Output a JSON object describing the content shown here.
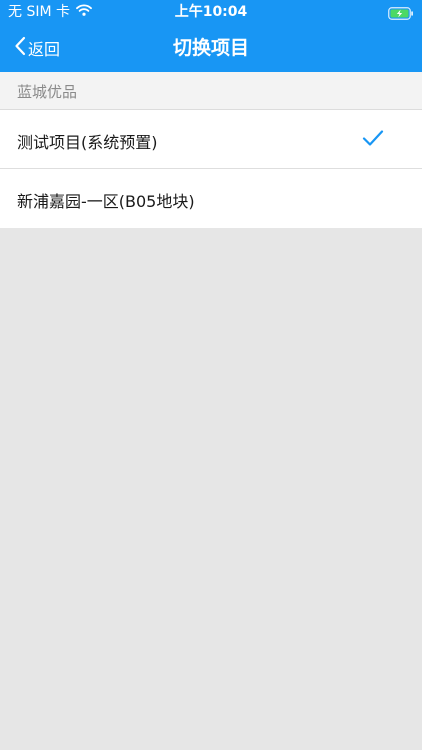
{
  "status_bar": {
    "carrier": "无 SIM 卡",
    "time": "上午10:04"
  },
  "nav": {
    "back_label": "返回",
    "title": "切换项目"
  },
  "section": {
    "header": "蓝城优品"
  },
  "projects": [
    {
      "name": "测试项目(系统预置)",
      "selected": true
    },
    {
      "name": "新浦嘉园-一区(B05地块)",
      "selected": false
    }
  ],
  "colors": {
    "nav_background": "#1896f4",
    "check": "#1896f4",
    "page_background": "#e6e6e6"
  },
  "icons": {
    "wifi": "wifi-icon",
    "battery": "battery-charging-icon",
    "back": "chevron-left-icon",
    "check": "checkmark-icon"
  }
}
